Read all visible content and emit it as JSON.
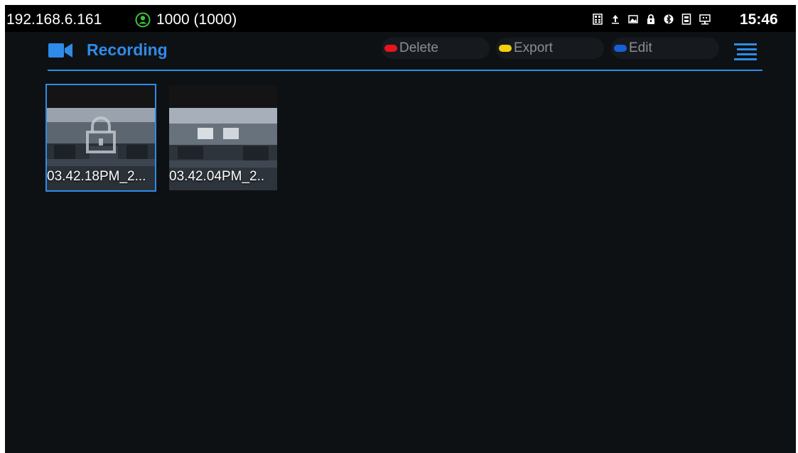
{
  "status_bar": {
    "ip": "192.168.6.161",
    "account": "1000 (1000)",
    "account_icon": "user-circle-icon",
    "account_icon_color": "#3cc33c",
    "icons": [
      "calculator-icon",
      "upload-icon",
      "image-icon",
      "lock-icon",
      "bluetooth-icon",
      "sim-icon",
      "network-icon"
    ],
    "time": "15:46"
  },
  "header": {
    "icon": "video-camera-icon",
    "title": "Recording",
    "accent": "#2f8be8"
  },
  "softkeys": {
    "delete": {
      "label": "Delete",
      "color": "#e8141c"
    },
    "export": {
      "label": "Export",
      "color": "#f2d10a"
    },
    "edit": {
      "label": "Edit",
      "color": "#1560d8"
    }
  },
  "menu_icon": "menu-icon",
  "recordings": [
    {
      "label": "03.42.18PM_2...",
      "locked": true,
      "selected": true
    },
    {
      "label": "03.42.04PM_2..",
      "locked": false,
      "selected": false
    }
  ]
}
